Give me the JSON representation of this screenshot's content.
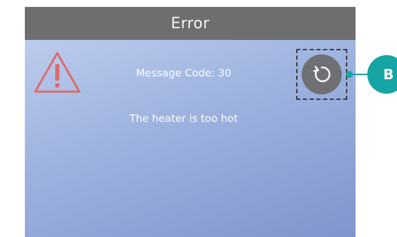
{
  "screen": {
    "title": "Error",
    "message_code": "Message Code: 30",
    "message_text": "The heater is too hot",
    "warning_icon": "warning-triangle-icon",
    "reset_icon": "refresh-icon"
  },
  "callout": {
    "label": "B"
  },
  "colors": {
    "title_bar": "#6e6e6e",
    "warning": "#e06a6a",
    "callout": "#15a5a4",
    "reset_button": "#6f7073"
  }
}
